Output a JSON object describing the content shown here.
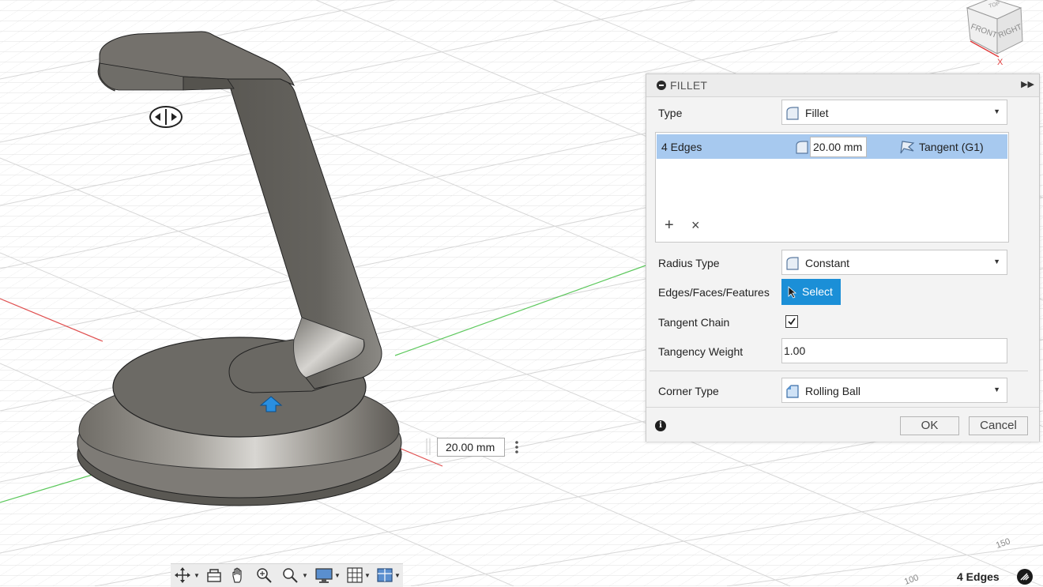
{
  "viewcube": {
    "front": "FRONT",
    "right": "RIGHT",
    "top": "TOP",
    "axis_x": "X"
  },
  "grid_labels": [
    "150",
    "100"
  ],
  "fillet_panel": {
    "title": "FILLET",
    "type_label": "Type",
    "type_value": "Fillet",
    "edge_set": {
      "label": "4 Edges",
      "radius": "20.00 mm",
      "continuity": "Tangent (G1)"
    },
    "add_symbol": "+",
    "remove_symbol": "×",
    "radius_type_label": "Radius Type",
    "radius_type_value": "Constant",
    "selection_label": "Edges/Faces/Features",
    "select_button": "Select",
    "tangent_chain_label": "Tangent Chain",
    "tangent_chain_checked": true,
    "tangency_weight_label": "Tangency Weight",
    "tangency_weight_value": "1.00",
    "corner_type_label": "Corner Type",
    "corner_type_value": "Rolling Ball",
    "ok_button": "OK",
    "cancel_button": "Cancel",
    "info_symbol": "i"
  },
  "manipulator_input": {
    "value": "20.00 mm"
  },
  "status_bar": {
    "selection_count": "4 Edges"
  },
  "nav_toolbar": {
    "tools": [
      "orbit-icon",
      "look-at-icon",
      "pan-icon",
      "zoom-icon",
      "fit-icon",
      "display-settings-icon",
      "grid-settings-icon",
      "viewports-icon"
    ]
  },
  "colors": {
    "selection_highlight": "#a7c9ef",
    "select_button": "#1b8fd7",
    "model_body": "#6b6963",
    "x_axis": "#e05050",
    "y_axis": "#5cc85c"
  }
}
